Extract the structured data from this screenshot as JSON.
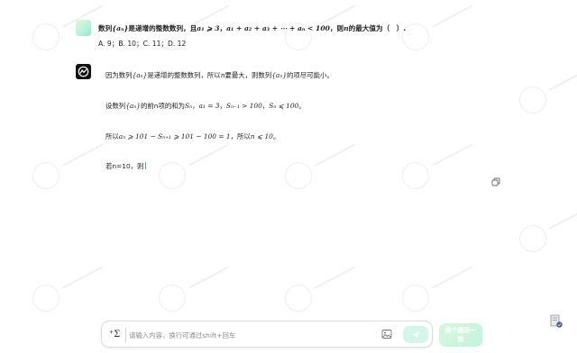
{
  "question": {
    "pre": "数列",
    "seq": "{aₙ}",
    "mid": "是递增的整数数列，且",
    "cond1": "a₁ ⩾ 3",
    "sep": "，",
    "cond2": "a₁ + a₂ + a₃ + ⋯ + aₙ < 100",
    "post1": "，则",
    "var": "n",
    "post2": "的最大值为（　）."
  },
  "options": "A. 9；B. 10；C. 11；D. 12",
  "answer": {
    "l1": {
      "a": "因为数列",
      "seq": "{aₙ}",
      "b": "是递增的整数数列，所以",
      "n": "n",
      "c": "要最大，则数列",
      "seq2": "{aₙ}",
      "d": "的项尽可能小。"
    },
    "l2": {
      "a": "设数列",
      "seq": "{aₙ}",
      "b": "的前n项的和为",
      "s": "Sₙ",
      "c": "，",
      "m1": "a₁ = 3",
      "d": "，",
      "m2": "Sₙ₋₁ > 100",
      "e": "，",
      "m3": "Sₙ ⩽ 100",
      "f": "。"
    },
    "l3": {
      "a": "所以",
      "m1": "aₙ ⩾ 101 − Sₙ₊₁ ⩾ 101 − 100 = 1",
      "b": "，所以",
      "m2": "n ⩽ 10",
      "c": "。"
    },
    "l4": "若n=10，则"
  },
  "input": {
    "placeholder": "请输入内容，换行可通过shift+回车",
    "formula_label": "⁺Σ"
  },
  "next_button": "换个题目一键"
}
